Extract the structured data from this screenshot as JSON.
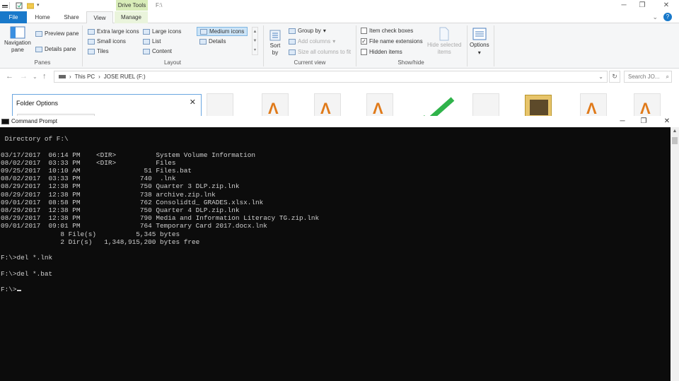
{
  "explorer": {
    "drive_tools": "Drive Tools",
    "path_title": "F:\\",
    "tabs": [
      "File",
      "Home",
      "Share",
      "View",
      "Manage"
    ],
    "ribbon": {
      "panes": {
        "nav_pane": "Navigation",
        "nav_pane2": "pane",
        "preview": "Preview pane",
        "details": "Details pane",
        "label": "Panes"
      },
      "layout": {
        "extra_large": "Extra large icons",
        "large": "Large icons",
        "medium": "Medium icons",
        "small": "Small icons",
        "list": "List",
        "details": "Details",
        "tiles": "Tiles",
        "content": "Content",
        "label": "Layout"
      },
      "current_view": {
        "sort_by": "Sort",
        "sort_by2": "by",
        "group_by": "Group by",
        "add_columns": "Add columns",
        "size_all": "Size all columns to fit",
        "label": "Current view"
      },
      "show_hide": {
        "item_check": "Item check boxes",
        "file_ext": "File name extensions",
        "hidden": "Hidden items",
        "hide_selected": "Hide selected",
        "hide_selected2": "items",
        "label": "Show/hide"
      },
      "options": "Options"
    },
    "address": {
      "this_pc": "This PC",
      "sep": "›",
      "drive": "JOSE RUEL (F:)"
    },
    "search_placeholder": "Search JO..."
  },
  "folder_options": {
    "title": "Folder Options"
  },
  "cmd": {
    "title": "Command Prompt",
    "lines": [
      "",
      " Directory of F:\\",
      "",
      "03/17/2017  06:14 PM    <DIR>          System Volume Information",
      "08/02/2017  03:33 PM    <DIR>          Files",
      "09/25/2017  10:10 AM                51 Files.bat",
      "08/02/2017  03:33 PM               740  .lnk",
      "08/29/2017  12:38 PM               750 Quarter 3 DLP.zip.lnk",
      "08/29/2017  12:38 PM               738 archive.zip.lnk",
      "09/01/2017  08:58 PM               762 Consolidtd_ GRADES.xlsx.lnk",
      "08/29/2017  12:38 PM               750 Quarter 4 DLP.zip.lnk",
      "08/29/2017  12:38 PM               790 Media and Information Literacy TG.zip.lnk",
      "09/01/2017  09:01 PM               764 Temporary Card 2017.docx.lnk",
      "               8 File(s)          5,345 bytes",
      "               2 Dir(s)   1,348,915,200 bytes free",
      "",
      "F:\\>del *.lnk",
      "",
      "F:\\>del *.bat",
      "",
      "F:\\>"
    ]
  }
}
